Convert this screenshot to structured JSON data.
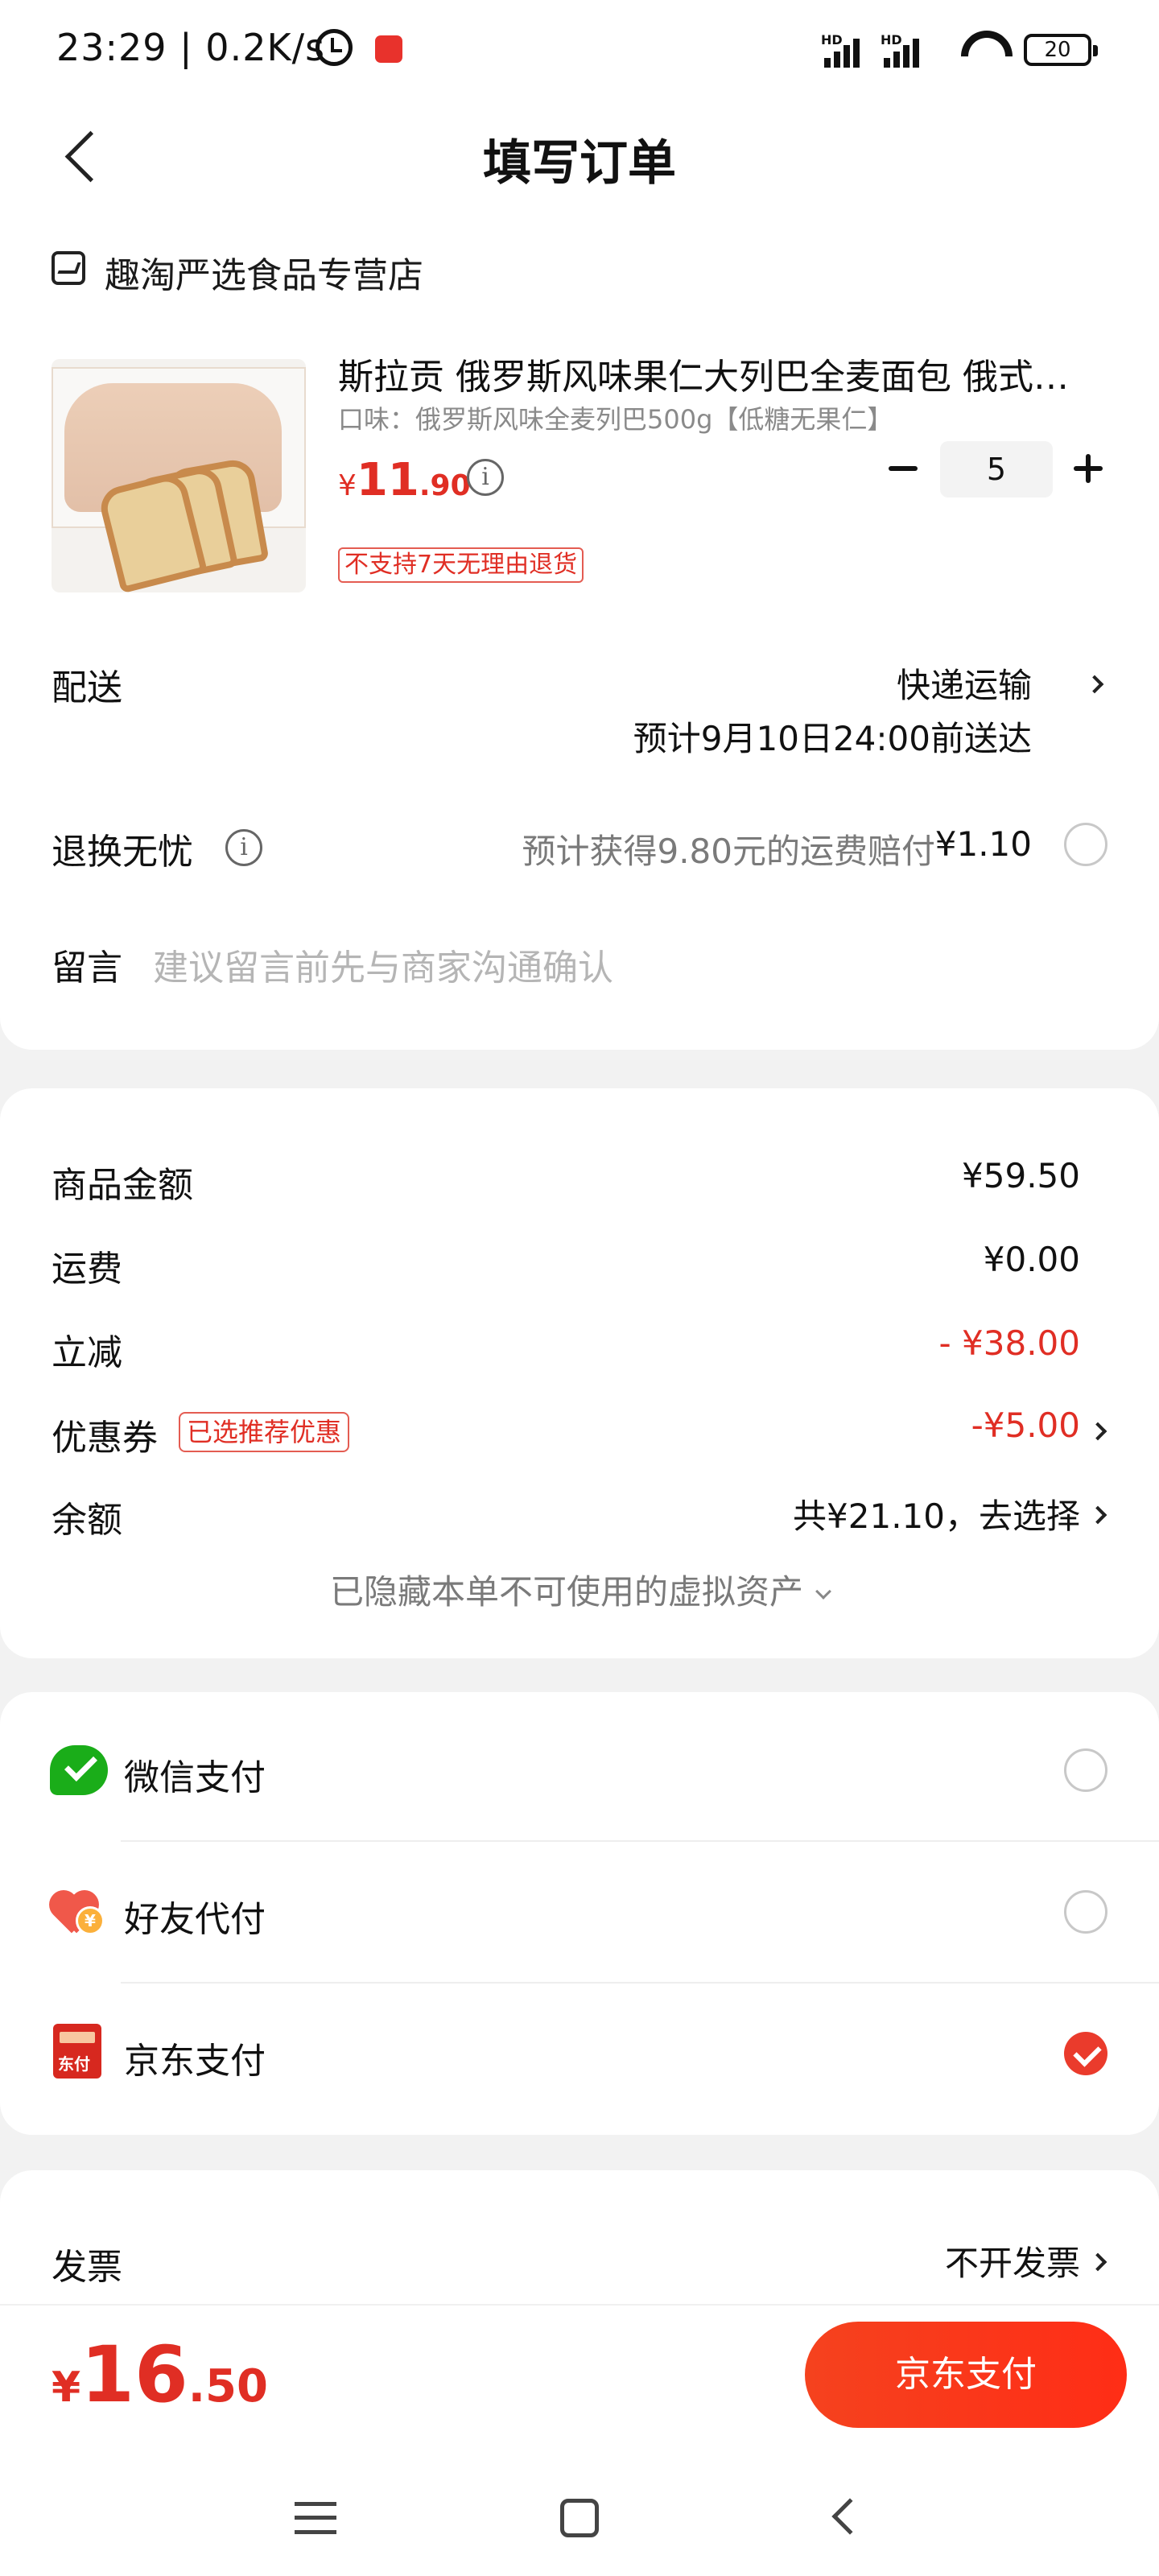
{
  "status_bar": {
    "time": "23:29 | 0.2K/s",
    "signal_label_1": "HD",
    "signal_label_2": "HD",
    "battery": "20"
  },
  "header": {
    "title": "填写订单"
  },
  "shop": {
    "name": "趣淘严选食品专营店"
  },
  "product": {
    "title": "斯拉贡 俄罗斯风味果仁大列巴全麦面包 俄式大列巴",
    "spec": "口味：俄罗斯风味全麦列巴500g【低糖无果仁】",
    "price_symbol": "¥",
    "price_int": "11",
    "price_dec": ".90",
    "quantity": "5",
    "return_policy": "不支持7天无理由退货"
  },
  "delivery": {
    "label": "配送",
    "method": "快递运输",
    "eta": "预计9月10日24:00前送达"
  },
  "return_insurance": {
    "label": "退换无忧",
    "note": "预计获得9.80元的运费赔付",
    "price": "¥1.10"
  },
  "message": {
    "label": "留言",
    "placeholder": "建议留言前先与商家沟通确认"
  },
  "summary": {
    "goods_label": "商品金额",
    "goods_value": "¥59.50",
    "shipping_label": "运费",
    "shipping_value": "¥0.00",
    "discount_label": "立减",
    "discount_value": "- ¥38.00",
    "coupon_label": "优惠券",
    "coupon_tag": "已选推荐优惠",
    "coupon_value": "-¥5.00",
    "balance_label": "余额",
    "balance_value": "共¥21.10，去选择",
    "hidden_assets": "已隐藏本单不可使用的虚拟资产"
  },
  "payment_methods": [
    {
      "label": "微信支付",
      "icon": "wechat-pay-icon",
      "selected": false
    },
    {
      "label": "好友代付",
      "icon": "friend-pay-icon",
      "selected": false
    },
    {
      "label": "京东支付",
      "icon": "jd-pay-icon",
      "icon_text": "东付",
      "selected": true
    }
  ],
  "invoice": {
    "label": "发票",
    "value": "不开发票"
  },
  "footer": {
    "total_symbol": "¥",
    "total_int": "16",
    "total_dec": ".50",
    "pay_button": "京东支付"
  },
  "colors": {
    "accent_red": "#e02e24",
    "pay_button": "#ff2d16",
    "wechat_green": "#1aad19"
  }
}
